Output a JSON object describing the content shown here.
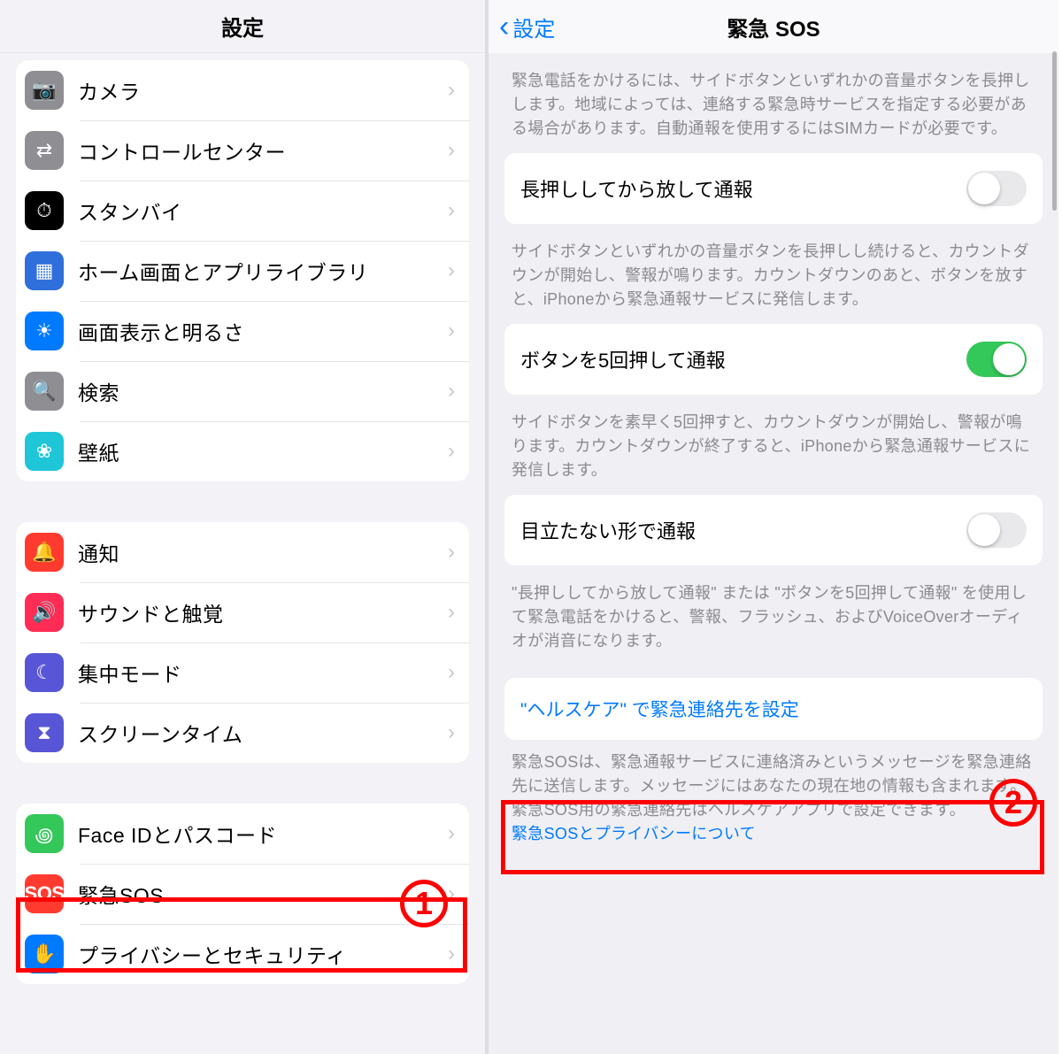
{
  "left": {
    "title": "設定",
    "groups": [
      [
        {
          "key": "camera",
          "icon": "camera-icon",
          "iconClass": "ic-camera",
          "glyph": "📷",
          "label": "カメラ"
        },
        {
          "key": "control",
          "icon": "control-center-icon",
          "iconClass": "ic-control",
          "glyph": "⇄",
          "label": "コントロールセンター"
        },
        {
          "key": "standby",
          "icon": "standby-icon",
          "iconClass": "ic-standby",
          "glyph": "⏱",
          "label": "スタンバイ"
        },
        {
          "key": "home",
          "icon": "home-screen-icon",
          "iconClass": "ic-home",
          "glyph": "▦",
          "label": "ホーム画面とアプリライブラリ"
        },
        {
          "key": "display",
          "icon": "display-icon",
          "iconClass": "ic-display",
          "glyph": "☀",
          "label": "画面表示と明るさ"
        },
        {
          "key": "search",
          "icon": "search-icon",
          "iconClass": "ic-search",
          "glyph": "🔍",
          "label": "検索"
        },
        {
          "key": "wallpaper",
          "icon": "wallpaper-icon",
          "iconClass": "ic-wall",
          "glyph": "❀",
          "label": "壁紙"
        }
      ],
      [
        {
          "key": "notif",
          "icon": "notifications-icon",
          "iconClass": "ic-notif",
          "glyph": "🔔",
          "label": "通知"
        },
        {
          "key": "sound",
          "icon": "sound-icon",
          "iconClass": "ic-sound",
          "glyph": "🔊",
          "label": "サウンドと触覚"
        },
        {
          "key": "focus",
          "icon": "focus-icon",
          "iconClass": "ic-focus",
          "glyph": "☾",
          "label": "集中モード"
        },
        {
          "key": "screen",
          "icon": "screen-time-icon",
          "iconClass": "ic-screen",
          "glyph": "⧗",
          "label": "スクリーンタイム"
        }
      ],
      [
        {
          "key": "faceid",
          "icon": "faceid-icon",
          "iconClass": "ic-faceid",
          "glyph": "꩜",
          "label": "Face IDとパスコード"
        },
        {
          "key": "sos",
          "icon": "sos-icon",
          "iconClass": "ic-sos",
          "glyph": "SOS",
          "label": "緊急SOS"
        },
        {
          "key": "privacy",
          "icon": "privacy-icon",
          "iconClass": "ic-privacy",
          "glyph": "✋",
          "label": "プライバシーとセキュリティ"
        }
      ]
    ]
  },
  "right": {
    "backLabel": "設定",
    "title": "緊急 SOS",
    "intro": "緊急電話をかけるには、サイドボタンといずれかの音量ボタンを長押しします。地域によっては、連絡する緊急時サービスを指定する必要がある場合があります。自動通報を使用するにはSIMカードが必要です。",
    "option1": {
      "label": "長押ししてから放して通報",
      "on": false
    },
    "explain1": "サイドボタンといずれかの音量ボタンを長押しし続けると、カウントダウンが開始し、警報が鳴ります。カウントダウンのあと、ボタンを放すと、iPhoneから緊急通報サービスに発信します。",
    "option2": {
      "label": "ボタンを5回押して通報",
      "on": true
    },
    "explain2": "サイドボタンを素早く5回押すと、カウントダウンが開始し、警報が鳴ります。カウントダウンが終了すると、iPhoneから緊急通報サービスに発信します。",
    "option3": {
      "label": "目立たない形で通報",
      "on": false
    },
    "explain3": "\"長押ししてから放して通報\" または \"ボタンを5回押して通報\" を使用して緊急電話をかけると、警報、フラッシュ、およびVoiceOverオーディオが消音になります。",
    "healthLink": "\"ヘルスケア\" で緊急連絡先を設定",
    "finalExplain": "緊急SOSは、緊急通報サービスに連絡済みというメッセージを緊急連絡先に送信します。メッセージにはあなたの現在地の情報も含まれます。緊急SOS用の緊急連絡先はヘルスケアアプリで設定できます。",
    "privacyLink": "緊急SOSとプライバシーについて"
  },
  "annotations": {
    "num1": "1",
    "num2": "2"
  }
}
